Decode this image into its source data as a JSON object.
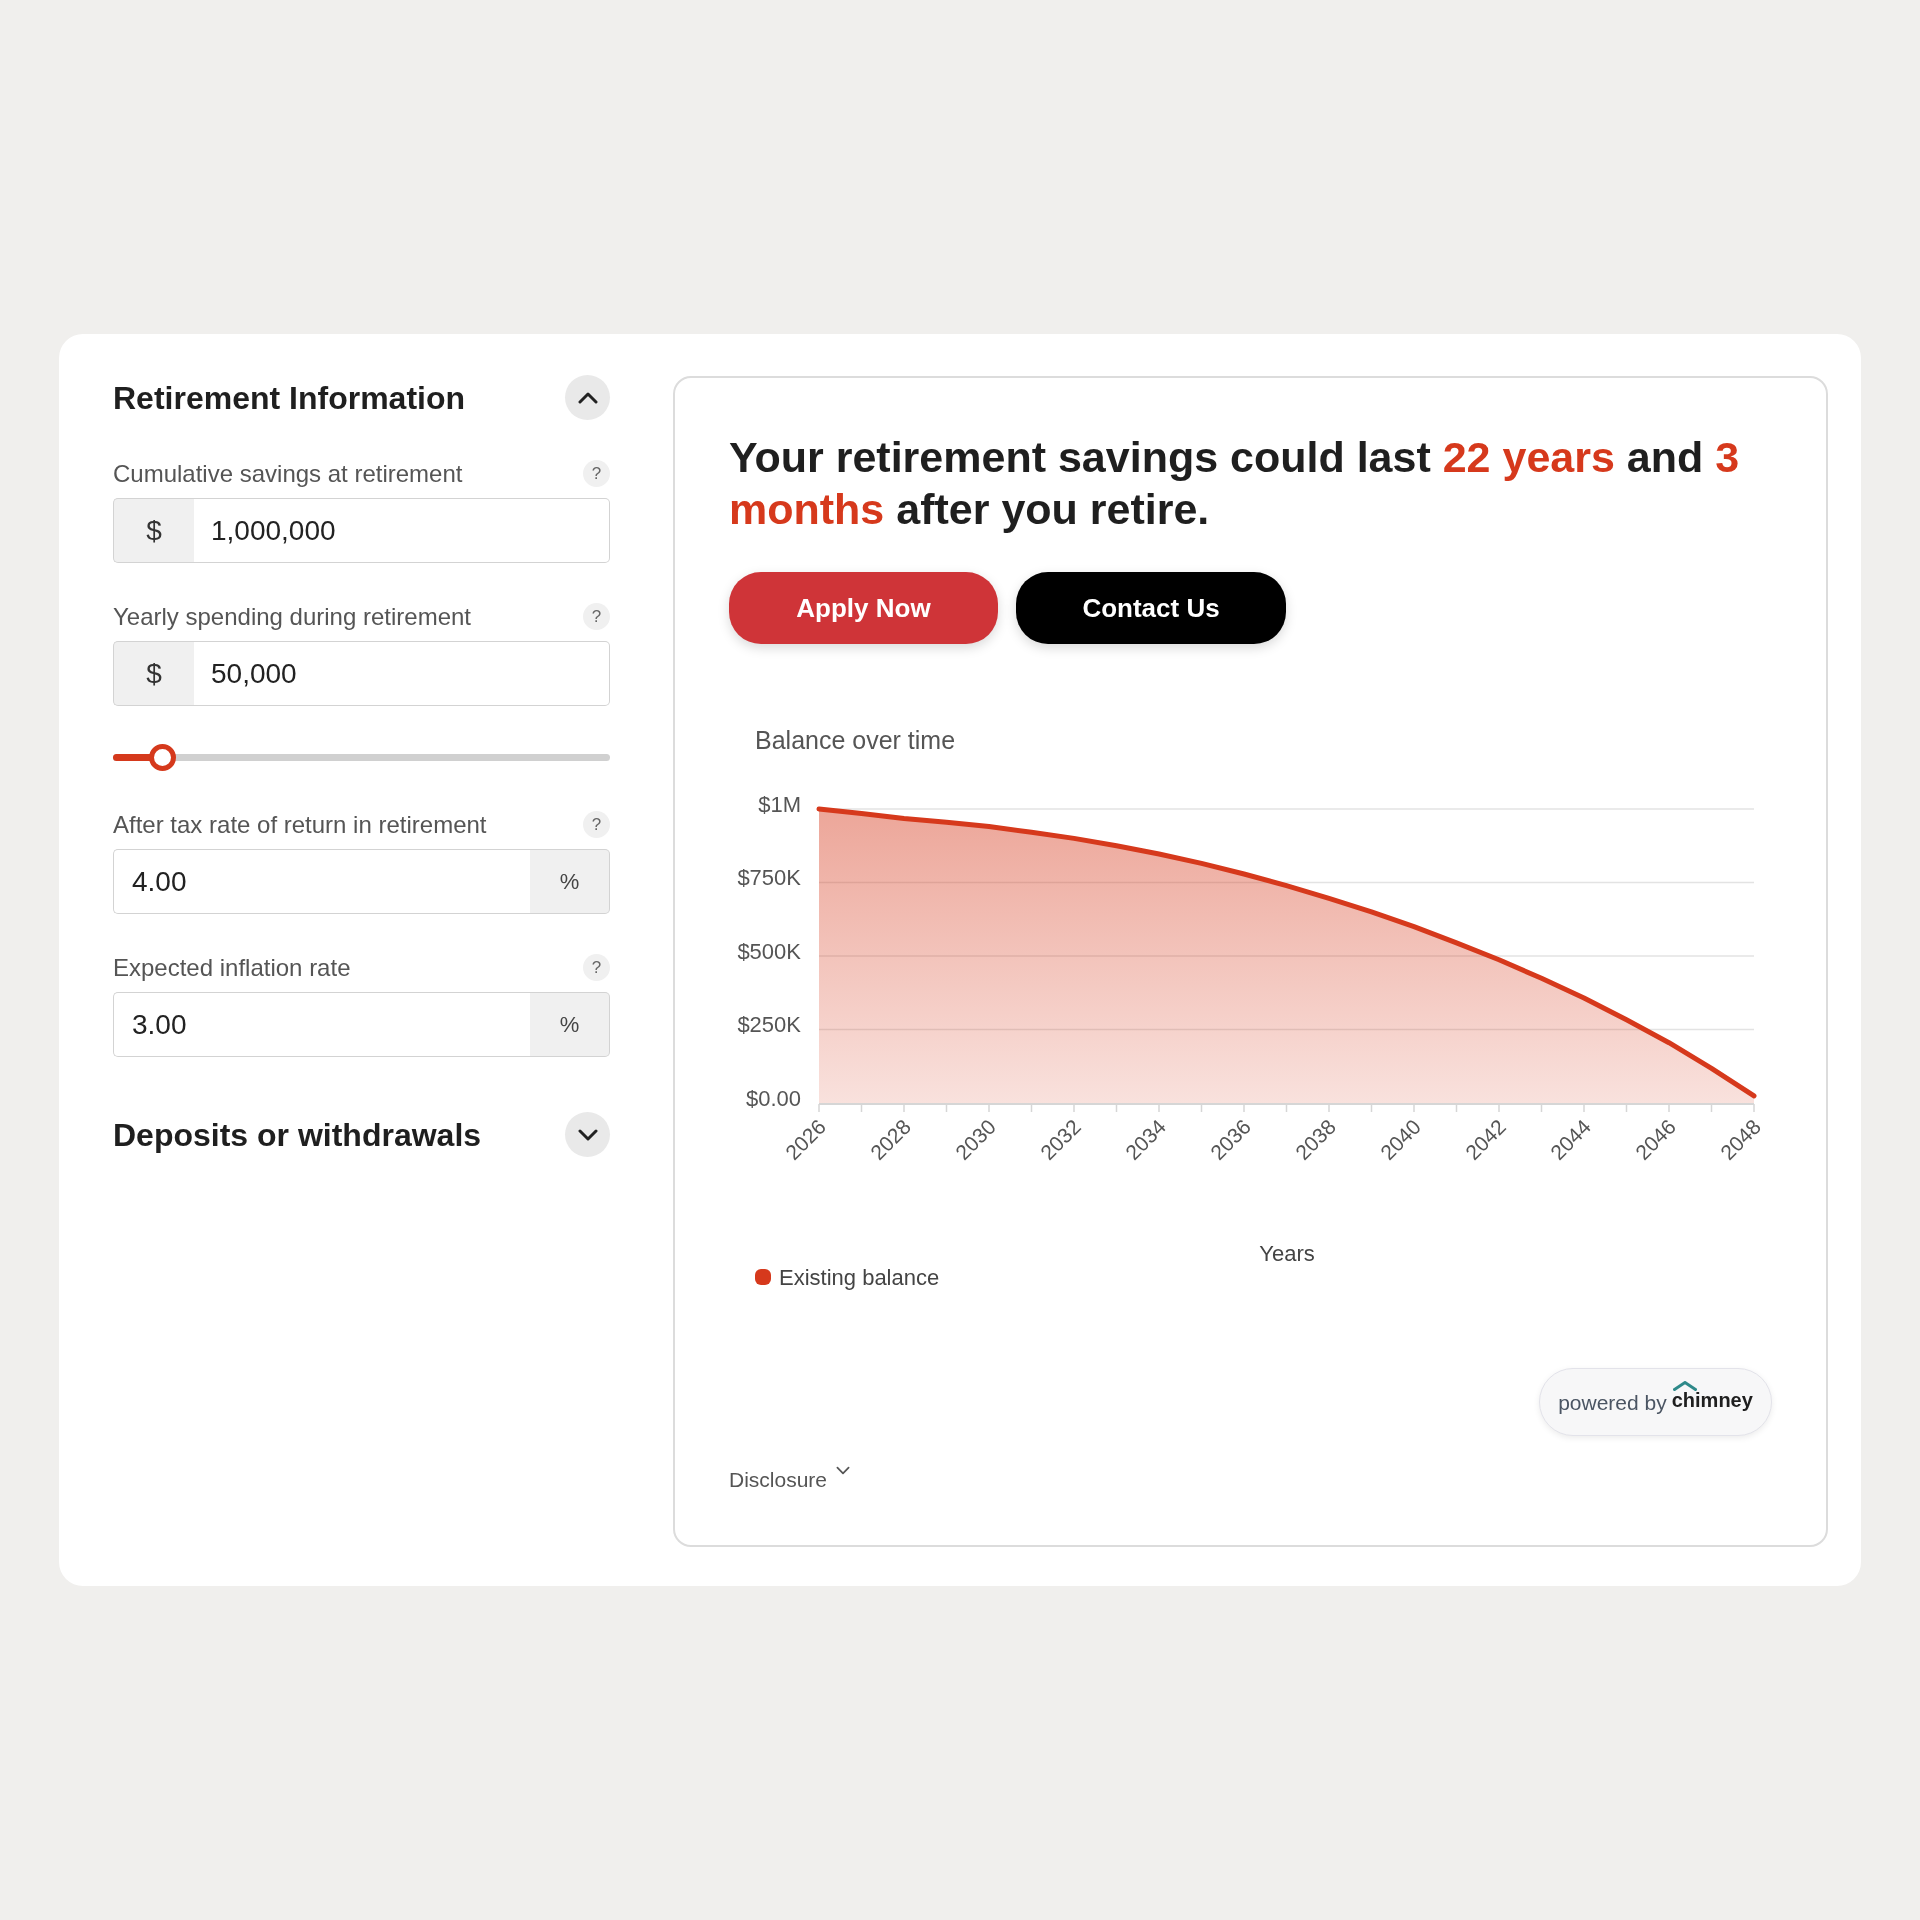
{
  "sections": [
    {
      "title": "Retirement Information",
      "expanded": true,
      "fields": [
        {
          "label": "Cumulative savings at retirement",
          "help": "?",
          "unit": "$",
          "kind": "prefix",
          "value": "1,000,000"
        },
        {
          "label": "Yearly spending during retirement",
          "help": "?",
          "unit": "$",
          "kind": "prefix",
          "value": "50,000",
          "slider": {
            "level": 0.1
          }
        },
        {
          "label": "After tax rate of return in retirement",
          "help": "?",
          "unit": "%",
          "kind": "suffix",
          "value": "4.00"
        },
        {
          "label": "Expected inflation rate",
          "help": "?",
          "unit": "%",
          "kind": "suffix",
          "value": "3.00"
        }
      ]
    },
    {
      "title": "Deposits or withdrawals",
      "expanded": false
    }
  ],
  "result": {
    "headline": [
      {
        "text": "Your retirement savings could last ",
        "highlight": false
      },
      {
        "text": "22 years",
        "highlight": true
      },
      {
        "text": " and ",
        "highlight": false
      },
      {
        "text": "3 months",
        "highlight": true
      },
      {
        "text": " after you retire.",
        "highlight": false
      }
    ],
    "buttons": [
      {
        "label": "Apply Now",
        "kind": "primary"
      },
      {
        "label": "Contact Us",
        "kind": "secondary"
      }
    ]
  },
  "chart": {
    "chart_data": {
      "type": "area",
      "title": "Balance over time",
      "xlabel": "Years",
      "x": [
        2026,
        2027,
        2028,
        2029,
        2030,
        2031,
        2032,
        2033,
        2034,
        2035,
        2036,
        2037,
        2038,
        2039,
        2040,
        2041,
        2042,
        2043,
        2044,
        2045,
        2046,
        2047,
        2048
      ],
      "series": [
        {
          "name": "Existing balance",
          "color": "#d6391c",
          "values": [
            1000000,
            985000,
            968000,
            955000,
            940000,
            921000,
            900000,
            875000,
            847000,
            815000,
            779000,
            739000,
            696000,
            650000,
            600000,
            545000,
            487000,
            424000,
            357000,
            283000,
            205000,
            118000,
            24000
          ]
        }
      ],
      "xlim": [
        2026,
        2048
      ],
      "ylim": [
        0,
        1000000
      ],
      "xticks": [
        2026,
        2028,
        2030,
        2032,
        2034,
        2036,
        2038,
        2040,
        2042,
        2044,
        2046,
        2048
      ],
      "yticks": [
        {
          "value": 0,
          "label": "$0.00"
        },
        {
          "value": 250000,
          "label": "$250K"
        },
        {
          "value": 500000,
          "label": "$500K"
        },
        {
          "value": 750000,
          "label": "$750K"
        },
        {
          "value": 1000000,
          "label": "$1M"
        }
      ],
      "grid": true
    }
  },
  "powered_by": {
    "text": "powered by",
    "brand": "chimney"
  },
  "disclosure": {
    "label": "Disclosure",
    "expanded": false
  }
}
